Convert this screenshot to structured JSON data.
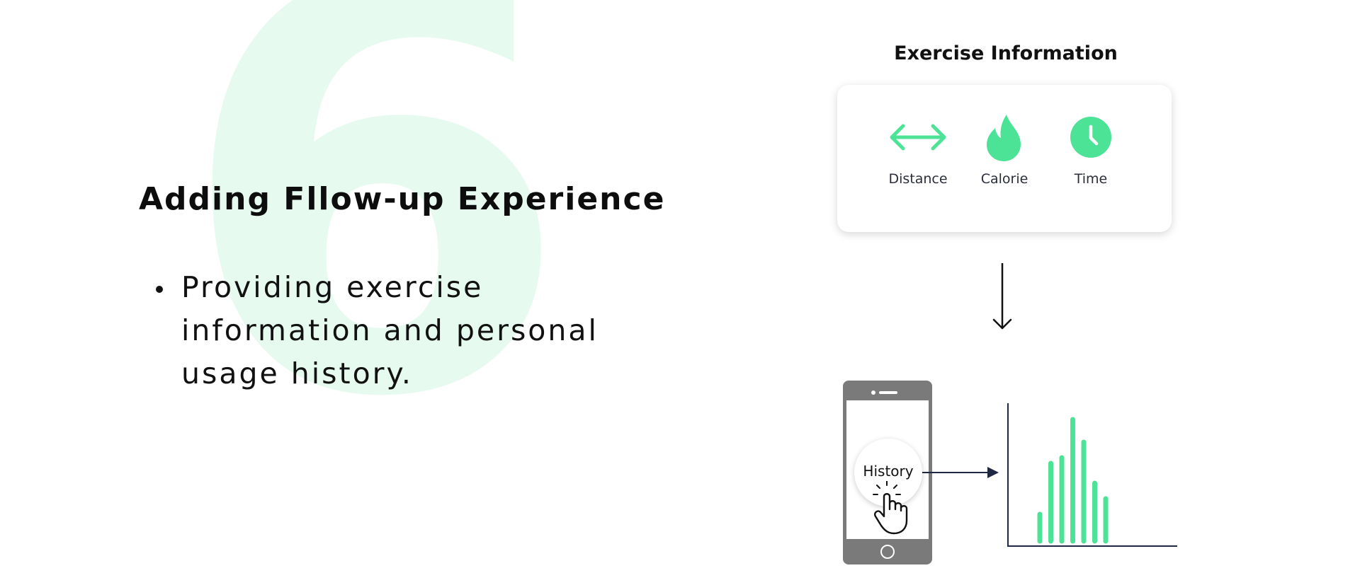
{
  "slide": {
    "number": "6",
    "title": "Adding Fllow-up Experience",
    "bullets": [
      "Providing exercise information and personal usage history."
    ]
  },
  "exercise_info": {
    "title": "Exercise Information",
    "metrics": [
      {
        "label": "Distance",
        "icon": "double-arrow-icon"
      },
      {
        "label": "Calorie",
        "icon": "flame-icon"
      },
      {
        "label": "Time",
        "icon": "clock-icon"
      }
    ]
  },
  "phone": {
    "button_label": "History"
  },
  "colors": {
    "accent": "#4de397",
    "watermark": "#e6faf0",
    "phone": "#7a7a7a",
    "navy": "#1e2840"
  },
  "chart_data": {
    "type": "bar",
    "values": [
      38,
      110,
      118,
      172,
      140,
      82,
      60
    ]
  }
}
